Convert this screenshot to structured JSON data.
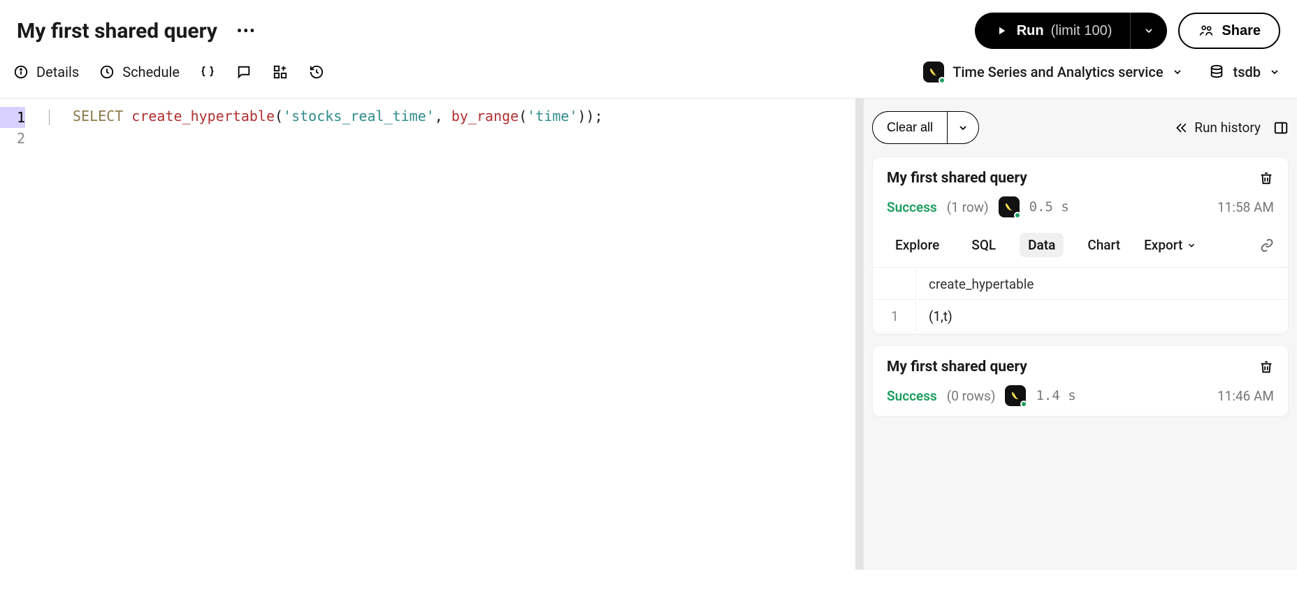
{
  "header": {
    "title": "My first shared query"
  },
  "actions": {
    "run_label": "Run",
    "run_limit": "(limit 100)",
    "share_label": "Share"
  },
  "subbar": {
    "details": "Details",
    "schedule": "Schedule"
  },
  "context": {
    "service": "Time Series and Analytics service",
    "database": "tsdb"
  },
  "editor": {
    "lines": {
      "l1": "1",
      "l2": "2"
    },
    "code": {
      "kw": "SELECT",
      "fn1": "create_hypertable",
      "p1": "(",
      "str1": "'stocks_real_time'",
      "comma": ", ",
      "fn2": "by_range",
      "p2": "(",
      "str2": "'time'",
      "p3": "));"
    }
  },
  "panel": {
    "clear": "Clear all",
    "history": "Run history"
  },
  "results": [
    {
      "title": "My first shared query",
      "status": "Success",
      "rows": "(1 row)",
      "duration": "0.5 s",
      "time": "11:58 AM",
      "tabs": {
        "explore": "Explore",
        "sql": "SQL",
        "data": "Data",
        "chart": "Chart",
        "export": "Export"
      },
      "table": {
        "header": "create_hypertable",
        "row_num": "1",
        "cell": "(1,t)"
      }
    },
    {
      "title": "My first shared query",
      "status": "Success",
      "rows": "(0 rows)",
      "duration": "1.4 s",
      "time": "11:46 AM"
    }
  ]
}
